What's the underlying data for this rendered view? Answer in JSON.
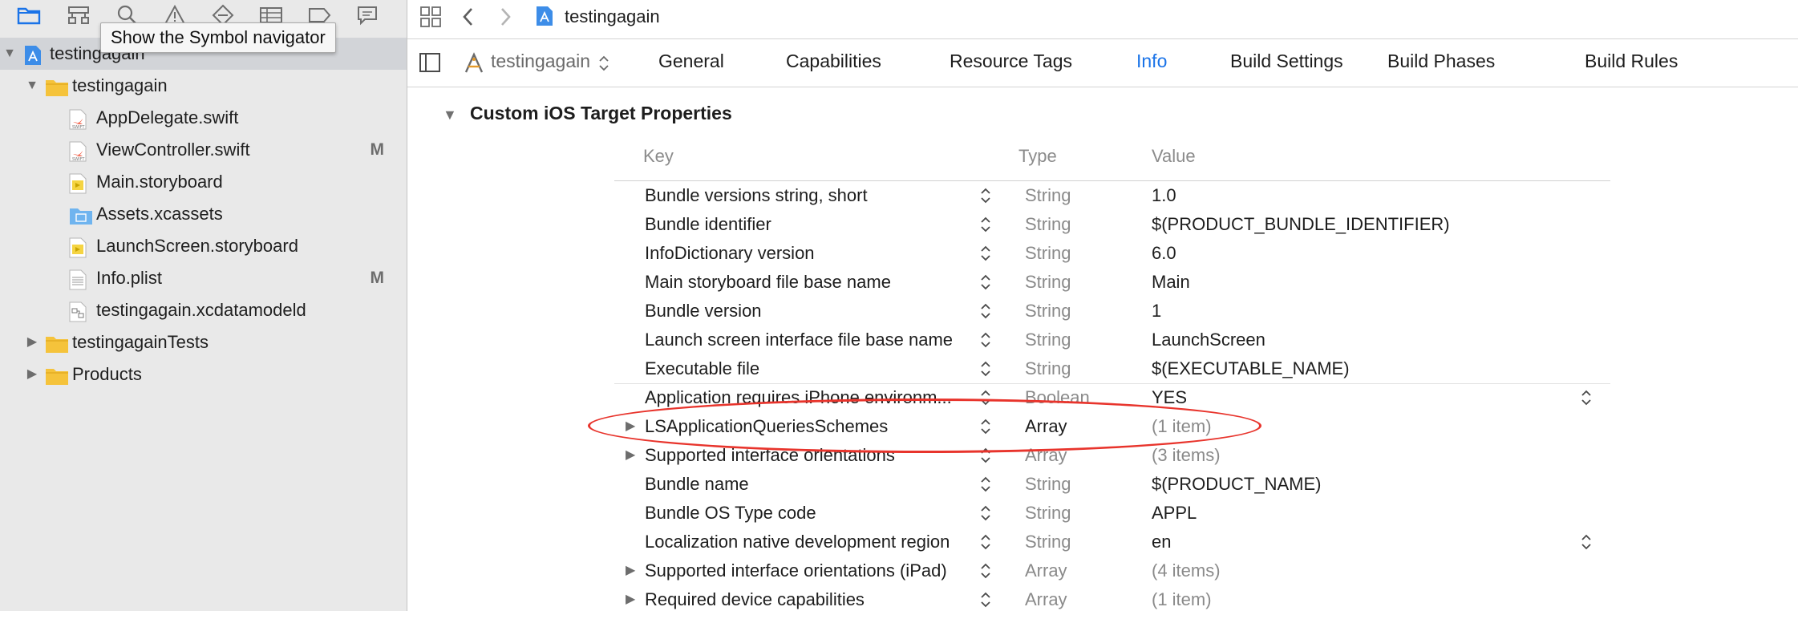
{
  "navigator": {
    "tooltip": "Show the Symbol navigator",
    "toolbar_icons": [
      "folder-icon",
      "hierarchy-icon",
      "search-icon",
      "warning-icon",
      "diamond-icon",
      "list-icon",
      "label-icon",
      "comment-icon"
    ],
    "tree": [
      {
        "label": "testingagain",
        "icon": "project-icon",
        "depth": 0,
        "expanded": true,
        "selected": true,
        "badge": ""
      },
      {
        "label": "testingagain",
        "icon": "folder-icon",
        "depth": 1,
        "expanded": true,
        "selected": false,
        "badge": ""
      },
      {
        "label": "AppDelegate.swift",
        "icon": "swift-file-icon",
        "depth": 2,
        "selected": false,
        "badge": ""
      },
      {
        "label": "ViewController.swift",
        "icon": "swift-file-icon",
        "depth": 2,
        "selected": false,
        "badge": "M"
      },
      {
        "label": "Main.storyboard",
        "icon": "storyboard-file-icon",
        "depth": 2,
        "selected": false,
        "badge": ""
      },
      {
        "label": "Assets.xcassets",
        "icon": "assets-folder-icon",
        "depth": 2,
        "selected": false,
        "badge": ""
      },
      {
        "label": "LaunchScreen.storyboard",
        "icon": "storyboard-file-icon",
        "depth": 2,
        "selected": false,
        "badge": ""
      },
      {
        "label": "Info.plist",
        "icon": "plist-file-icon",
        "depth": 2,
        "selected": false,
        "badge": "M"
      },
      {
        "label": "testingagain.xcdatamodeld",
        "icon": "datamodel-file-icon",
        "depth": 2,
        "selected": false,
        "badge": ""
      },
      {
        "label": "testingagainTests",
        "icon": "folder-icon",
        "depth": 1,
        "expanded": false,
        "selected": false,
        "badge": ""
      },
      {
        "label": "Products",
        "icon": "folder-icon",
        "depth": 1,
        "expanded": false,
        "selected": false,
        "badge": ""
      }
    ]
  },
  "jump_bar": {
    "file_label": "testingagain"
  },
  "target_bar": {
    "target_label": "testingagain",
    "tabs": [
      {
        "label": "General",
        "active": false
      },
      {
        "label": "Capabilities",
        "active": false
      },
      {
        "label": "Resource Tags",
        "active": false
      },
      {
        "label": "Info",
        "active": true
      },
      {
        "label": "Build Settings",
        "active": false
      },
      {
        "label": "Build Phases",
        "active": false
      },
      {
        "label": "Build Rules",
        "active": false
      }
    ]
  },
  "section": {
    "title": "Custom iOS Target Properties",
    "columns": {
      "key": "Key",
      "type": "Type",
      "value": "Value"
    },
    "rows": [
      {
        "key": "Bundle versions string, short",
        "type": "String",
        "value": "1.0",
        "disclosure": false,
        "value_dim": false,
        "type_dark": false,
        "right_stepper": false
      },
      {
        "key": "Bundle identifier",
        "type": "String",
        "value": "$(PRODUCT_BUNDLE_IDENTIFIER)",
        "disclosure": false,
        "value_dim": false,
        "type_dark": false,
        "right_stepper": false
      },
      {
        "key": "InfoDictionary version",
        "type": "String",
        "value": "6.0",
        "disclosure": false,
        "value_dim": false,
        "type_dark": false,
        "right_stepper": false
      },
      {
        "key": "Main storyboard file base name",
        "type": "String",
        "value": "Main",
        "disclosure": false,
        "value_dim": false,
        "type_dark": false,
        "right_stepper": false
      },
      {
        "key": "Bundle version",
        "type": "String",
        "value": "1",
        "disclosure": false,
        "value_dim": false,
        "type_dark": false,
        "right_stepper": false
      },
      {
        "key": "Launch screen interface file base name",
        "type": "String",
        "value": "LaunchScreen",
        "disclosure": false,
        "value_dim": false,
        "type_dark": false,
        "right_stepper": false
      },
      {
        "key": "Executable file",
        "type": "String",
        "value": "$(EXECUTABLE_NAME)",
        "disclosure": false,
        "value_dim": false,
        "type_dark": false,
        "right_stepper": false
      },
      {
        "key": "Application requires iPhone environm...",
        "type": "Boolean",
        "value": "YES",
        "disclosure": false,
        "value_dim": false,
        "type_dark": false,
        "right_stepper": true
      },
      {
        "key": "LSApplicationQueriesSchemes",
        "type": "Array",
        "value": "(1 item)",
        "disclosure": true,
        "value_dim": true,
        "type_dark": true,
        "right_stepper": false
      },
      {
        "key": "Supported interface orientations",
        "type": "Array",
        "value": "(3 items)",
        "disclosure": true,
        "value_dim": true,
        "type_dark": false,
        "right_stepper": false
      },
      {
        "key": "Bundle name",
        "type": "String",
        "value": "$(PRODUCT_NAME)",
        "disclosure": false,
        "value_dim": false,
        "type_dark": false,
        "right_stepper": false
      },
      {
        "key": "Bundle OS Type code",
        "type": "String",
        "value": "APPL",
        "disclosure": false,
        "value_dim": false,
        "type_dark": false,
        "right_stepper": false
      },
      {
        "key": "Localization native development region",
        "type": "String",
        "value": "en",
        "disclosure": false,
        "value_dim": false,
        "type_dark": false,
        "right_stepper": true
      },
      {
        "key": "Supported interface orientations (iPad)",
        "type": "Array",
        "value": "(4 items)",
        "disclosure": true,
        "value_dim": true,
        "type_dark": false,
        "right_stepper": false
      },
      {
        "key": "Required device capabilities",
        "type": "Array",
        "value": "(1 item)",
        "disclosure": true,
        "value_dim": true,
        "type_dark": false,
        "right_stepper": false
      }
    ]
  },
  "colors": {
    "accent": "#1a73e8",
    "highlight_oval": "#e8342c",
    "folder": "#f5c33b",
    "sidebar_bg": "#e9e9e9"
  }
}
